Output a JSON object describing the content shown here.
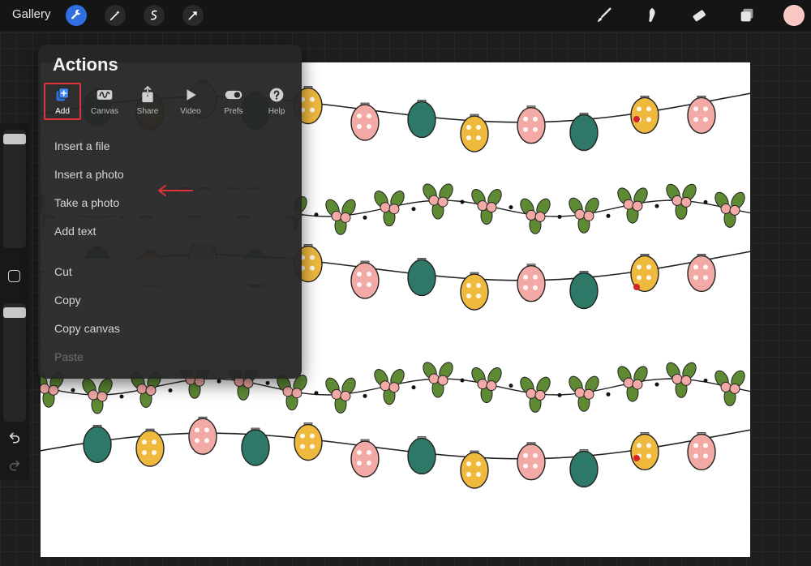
{
  "topbar": {
    "gallery_label": "Gallery",
    "left_tools": [
      "wrench-icon",
      "magic-wand-icon",
      "selection-icon",
      "transform-arrow-icon"
    ],
    "right_tools": [
      "brush-icon",
      "smudge-icon",
      "eraser-icon",
      "layers-icon"
    ],
    "current_color": "#f9c6c1",
    "accent_color": "#2f6fe0"
  },
  "actions": {
    "title": "Actions",
    "tabs": [
      {
        "label": "Add",
        "icon": "add-file-icon",
        "selected": true
      },
      {
        "label": "Canvas",
        "icon": "canvas-wave-icon",
        "selected": false
      },
      {
        "label": "Share",
        "icon": "share-icon",
        "selected": false
      },
      {
        "label": "Video",
        "icon": "play-icon",
        "selected": false
      },
      {
        "label": "Prefs",
        "icon": "toggle-icon",
        "selected": false
      },
      {
        "label": "Help",
        "icon": "help-icon",
        "selected": false
      }
    ],
    "items_group1": [
      "Insert a file",
      "Insert a photo",
      "Take a photo",
      "Add text"
    ],
    "items_group2": [
      "Cut",
      "Copy",
      "Copy canvas",
      "Paste"
    ],
    "disabled_items": [
      "Paste"
    ],
    "highlight_color": "#e0343c"
  },
  "sidebar": {
    "brush_size_level": 0.04,
    "opacity_level": 0.04,
    "icons": [
      "modify-square-icon",
      "undo-icon",
      "redo-icon"
    ]
  },
  "canvas_art": {
    "description_colors": {
      "teal": "#2e7868",
      "yellow": "#efb93e",
      "pink": "#f3aaa6",
      "leaf": "#5e8a34",
      "red": "#d8202a"
    }
  }
}
